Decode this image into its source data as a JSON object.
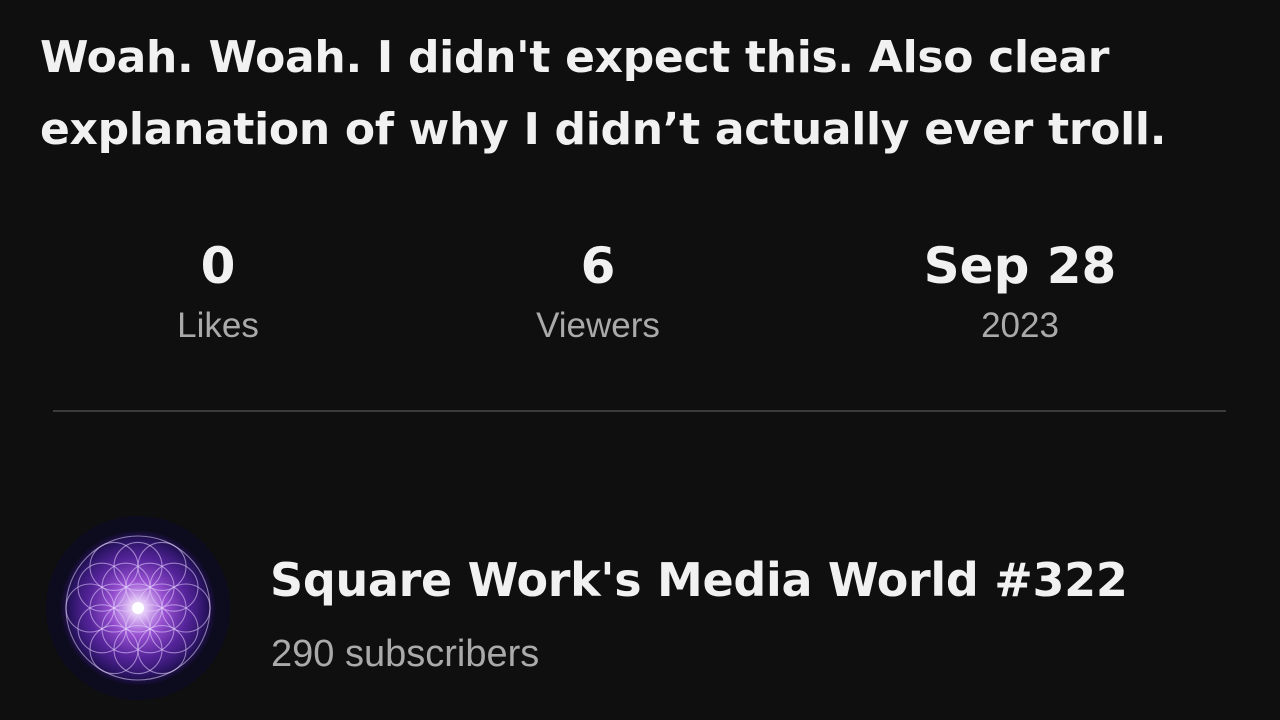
{
  "post": {
    "title": "Woah. Woah. I didn't expect this. Also clear explanation of why I didn’t actually ever troll."
  },
  "stats": {
    "likes": {
      "value": "0",
      "label": "Likes"
    },
    "viewers": {
      "value": "6",
      "label": "Viewers"
    },
    "date": {
      "value": "Sep 28",
      "label": "2023"
    }
  },
  "channel": {
    "name": "Square Work's Media World #322",
    "subscribers": "290 subscribers",
    "avatar_icon": "flower-of-life-icon",
    "avatar_colors": [
      "#8a2be2",
      "#c084fc",
      "#1a1036"
    ]
  }
}
